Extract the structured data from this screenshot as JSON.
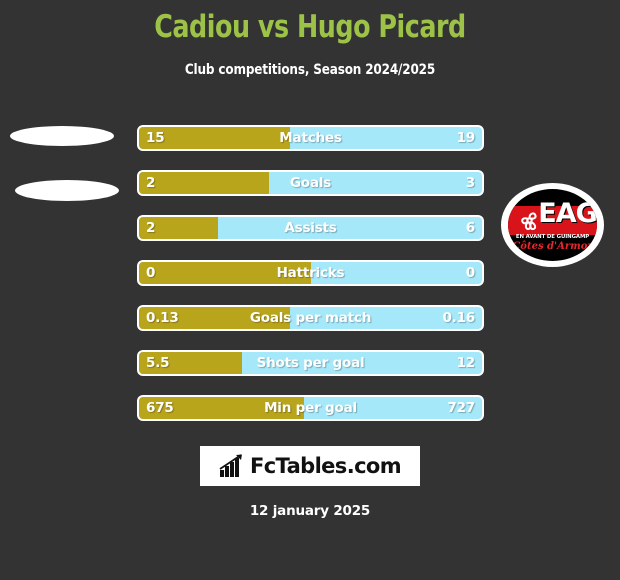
{
  "header": {
    "title": "Cadiou vs Hugo Picard",
    "subtitle": "Club competitions, Season 2024/2025",
    "title_color": "#9dc248"
  },
  "colors": {
    "background": "#333333",
    "home_bar": "#b9a51c",
    "away_bar": "#a5e8fa",
    "bar_border": "#ffffff",
    "text": "#ffffff"
  },
  "home_player": {
    "name": "Cadiou",
    "photo_placeholder": "ellipse"
  },
  "away_player": {
    "name": "Hugo Picard",
    "club_badge": {
      "initials": "EAG",
      "full_name": "EN AVANT DE GUINGAMP",
      "region": "Côtes d'Armor",
      "band_color": "#d8131a",
      "field_color": "#000000"
    }
  },
  "chart_data": {
    "type": "bar",
    "title": "Cadiou vs Hugo Picard",
    "subtitle": "Club competitions, Season 2024/2025",
    "orientation": "horizontal-diverging",
    "series": [
      {
        "name": "Cadiou",
        "color": "#b9a51c"
      },
      {
        "name": "Hugo Picard",
        "color": "#a5e8fa"
      }
    ],
    "categories": [
      "Matches",
      "Goals",
      "Assists",
      "Hattricks",
      "Goals per match",
      "Shots per goal",
      "Min per goal"
    ],
    "rows": [
      {
        "label": "Matches",
        "home": "15",
        "away": "19",
        "home_pct": 44
      },
      {
        "label": "Goals",
        "home": "2",
        "away": "3",
        "home_pct": 38
      },
      {
        "label": "Assists",
        "home": "2",
        "away": "6",
        "home_pct": 23
      },
      {
        "label": "Hattricks",
        "home": "0",
        "away": "0",
        "home_pct": 50
      },
      {
        "label": "Goals per match",
        "home": "0.13",
        "away": "0.16",
        "home_pct": 44
      },
      {
        "label": "Shots per goal",
        "home": "5.5",
        "away": "12",
        "home_pct": 30
      },
      {
        "label": "Min per goal",
        "home": "675",
        "away": "727",
        "home_pct": 48
      }
    ]
  },
  "footer": {
    "brand": "FcTables.com",
    "brand_icon": "bar-chart-arrow-icon",
    "date": "12 january 2025"
  }
}
